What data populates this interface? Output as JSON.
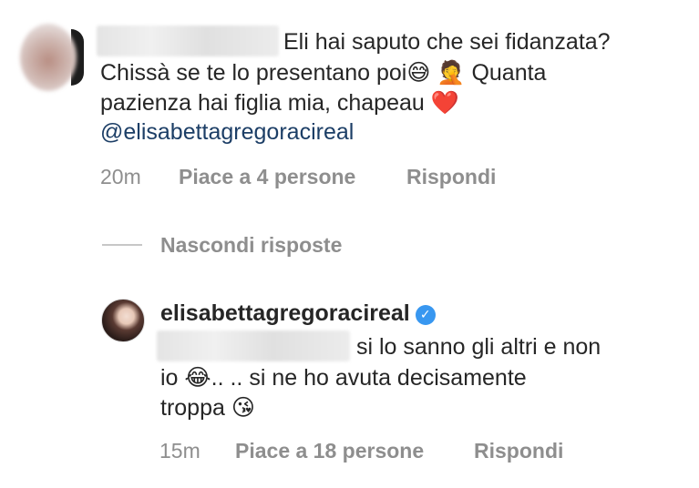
{
  "comment": {
    "text_line1": "Eli hai saputo che sei fidanzata?",
    "text_line2_a": "Chissà se te lo presentano poi",
    "emoji_sweat": "😅",
    "emoji_facepalm": "🤦",
    "text_line2_b": "Quanta",
    "text_line3": "pazienza hai figlia mia, chapeau",
    "emoji_heart": "❤️",
    "mention": "@elisabettagregoracireal",
    "time": "20m",
    "likes": "Piace a 4 persone",
    "reply": "Rispondi"
  },
  "hide_replies": "Nascondi risposte",
  "reply_comment": {
    "username": "elisabettagregoracireal",
    "verified_mark": "✓",
    "text_line1": "si lo sanno gli altri e non",
    "text_line2_a": "io",
    "emoji_laugh": "😂",
    "text_line2_b": ".. .. si ne ho avuta decisamente",
    "text_line3": "troppa",
    "emoji_kiss": "😘",
    "time": "15m",
    "likes": "Piace a 18 persone",
    "reply": "Rispondi"
  },
  "colors": {
    "text": "#262626",
    "meta": "#8e8e8e",
    "mention": "#1c3e66",
    "verified": "#3897f0"
  }
}
